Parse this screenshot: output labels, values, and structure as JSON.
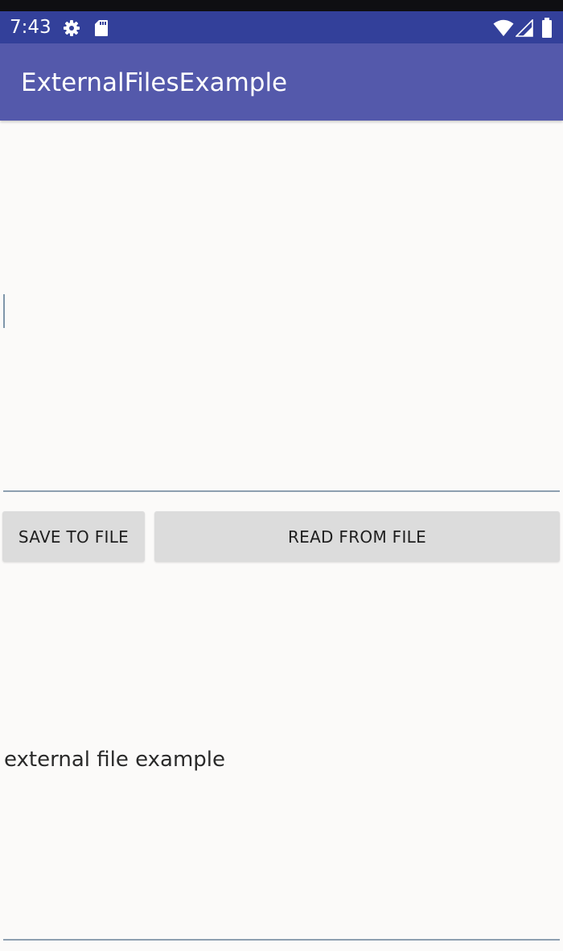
{
  "status_bar": {
    "time": "7:43",
    "left_icons": [
      "gear-icon",
      "sd-card-icon"
    ],
    "right_icons": [
      "wifi-icon",
      "signal-icon",
      "battery-icon"
    ],
    "color": "#33409a"
  },
  "app_bar": {
    "title": "ExternalFilesExample",
    "color": "#5459ab"
  },
  "input": {
    "value": ""
  },
  "buttons": {
    "save_label": "SAVE TO FILE",
    "read_label": "READ FROM FILE"
  },
  "output": {
    "text": "external file example"
  }
}
